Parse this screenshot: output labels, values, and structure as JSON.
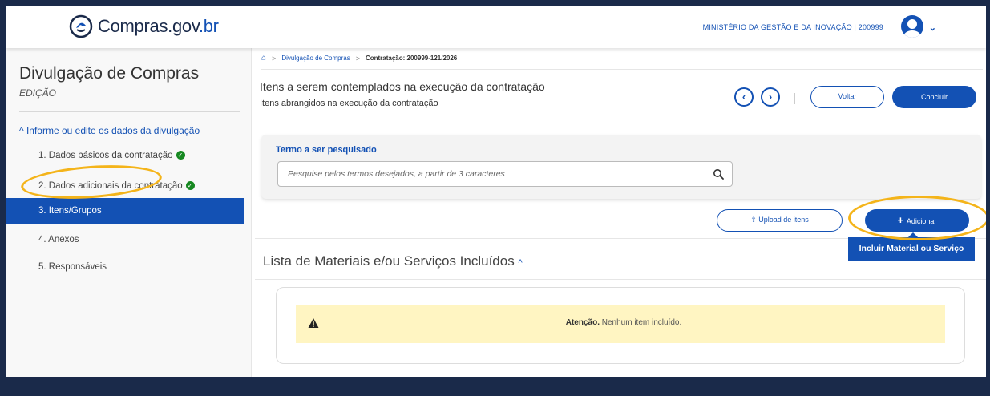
{
  "header": {
    "logo_text_main": "Compras",
    "logo_text_gov": ".gov",
    "logo_text_br": ".br",
    "ministry": "MINISTÉRIO DA GESTÃO E DA INOVAÇÃO | 200999"
  },
  "sidebar": {
    "title": "Divulgação de Compras",
    "subtitle": "EDIÇÃO",
    "section": "Informe ou edite os dados da divulgação",
    "items": [
      {
        "label": "1. Dados básicos da contratação",
        "checked": true
      },
      {
        "label": "2. Dados adicionais da contratação",
        "checked": true
      },
      {
        "label": "3. Itens/Grupos",
        "checked": false
      },
      {
        "label": "4. Anexos",
        "checked": false
      },
      {
        "label": "5. Responsáveis",
        "checked": false
      }
    ]
  },
  "breadcrumb": {
    "link": "Divulgação de Compras",
    "current": "Contratação: 200999-121/2026"
  },
  "main": {
    "title": "Itens a serem contemplados na execução da contratação",
    "subtitle": "Itens abrangidos na execução da contratação",
    "back_button": "Voltar",
    "finish_button": "Concluir",
    "search_label": "Termo a ser pesquisado",
    "search_placeholder": "Pesquise pelos termos desejados, a partir de 3 caracteres",
    "upload_button": "Upload de itens",
    "add_button": "Adicionar",
    "tooltip": "Incluir Material ou Serviço",
    "list_title": "Lista de Materiais e/ou Serviços Incluídos",
    "alert_strong": "Atenção.",
    "alert_text": " Nenhum item incluído."
  },
  "colors": {
    "primary": "#1351b4",
    "success": "#168821",
    "warning_bg": "#fff5c2",
    "highlight": "#f4b41a"
  }
}
